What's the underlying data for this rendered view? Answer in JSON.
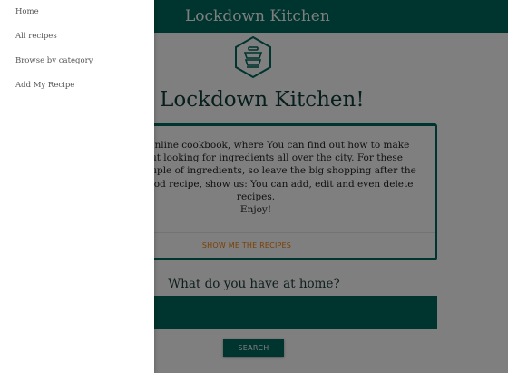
{
  "header": {
    "brand": "Lockdown Kitchen"
  },
  "logo": {
    "icon": "stacked-pots-hexagon-icon"
  },
  "welcome": {
    "heading": "me to Lockdown Kitchen!"
  },
  "intro_card": {
    "lines": [
      "hen is an online cookbook, where You can find out how to make",
      "od without looking for ingredients all over the city. For these",
      "ed just a couple of ingredients, so leave the big shopping after the",
      "u have a good recipe, show us: You can add, edit and even delete",
      "recipes.",
      "Enjoy!"
    ],
    "action": "SHOW ME THE RECIPES"
  },
  "search": {
    "question": "What do you have at home?",
    "value": "",
    "button": "SEARCH"
  },
  "sidenav": {
    "items": [
      {
        "label": "Home"
      },
      {
        "label": "All recipes"
      },
      {
        "label": "Browse by category"
      },
      {
        "label": "Add My Recipe"
      }
    ]
  },
  "colors": {
    "primary": "#00695c",
    "accent": "#f57c00",
    "overlay": "rgba(0,0,0,0.5)"
  }
}
